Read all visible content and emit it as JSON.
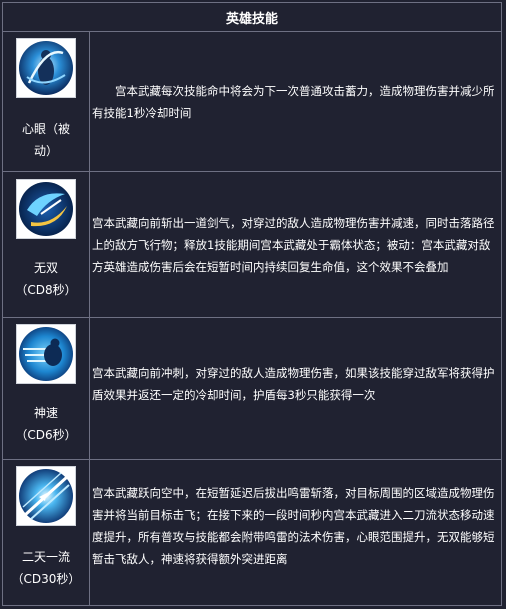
{
  "header": {
    "title": "英雄技能"
  },
  "skills": [
    {
      "name_line1": "心眼（被",
      "name_line2": "动）",
      "icon": "passive-skill-icon",
      "description": "宫本武藏每次技能命中将会为下一次普通攻击蓄力，造成物理伤害并减少所有技能1秒冷却时间"
    },
    {
      "name_line1": "无双",
      "name_line2": "（CD8秒）",
      "icon": "slash-skill-icon",
      "description": "宫本武藏向前斩出一道剑气，对穿过的敌人造成物理伤害并减速，同时击落路径上的敌方飞行物；释放1技能期间宫本武藏处于霸体状态；被动：宫本武藏对敌方英雄造成伤害后会在短暂时间内持续回复生命值，这个效果不会叠加"
    },
    {
      "name_line1": "神速",
      "name_line2": "（CD6秒）",
      "icon": "dash-skill-icon",
      "description": "宫本武藏向前冲刺，对穿过的敌人造成物理伤害，如果该技能穿过敌军将获得护盾效果并返还一定的冷却时间，护盾每3秒只能获得一次"
    },
    {
      "name_line1": "二天一流",
      "name_line2": "（CD30秒）",
      "icon": "ultimate-skill-icon",
      "description": "宫本武藏跃向空中，在短暂延迟后拔出鸣雷斩落，对目标周围的区域造成物理伤害并将当前目标击飞；在接下来的一段时间秒内宫本武藏进入二刀流状态移动速度提升，所有普攻与技能都会附带鸣雷的法术伤害，心眼范围提升，无双能够短暂击飞敌人，神速将获得额外突进距离"
    }
  ]
}
